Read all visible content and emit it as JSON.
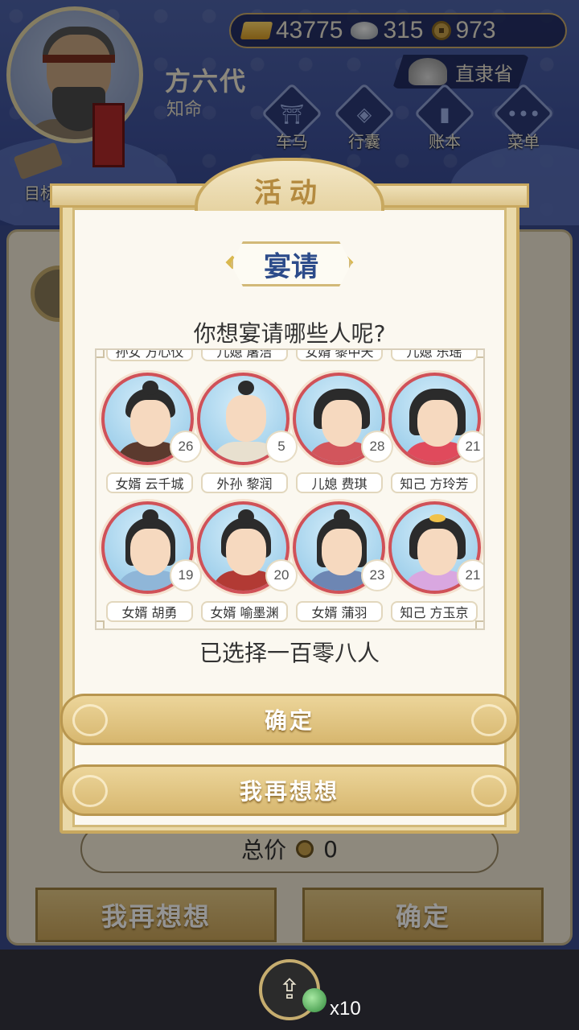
{
  "resources": {
    "gold": "43775",
    "silver": "315",
    "coins": "973"
  },
  "player": {
    "name": "方六代",
    "title": "知命",
    "province": "直隶省"
  },
  "menu": {
    "carriage": "车马",
    "bag": "行囊",
    "ledger": "账本",
    "menu": "菜单",
    "goal": "目标"
  },
  "background": {
    "total_label": "总价",
    "total_value": "0",
    "reconsider": "我再想想",
    "confirm": "确定",
    "share_count": "x10"
  },
  "dialog": {
    "title": "活动",
    "section": "宴请",
    "question": "你想宴请哪些人呢?",
    "partial_row": [
      "孙女 方心仪",
      "儿媳 屠洁",
      "女婿 黎中天",
      "儿媳 乐瑶"
    ],
    "characters": [
      {
        "label": "女婿 云千城",
        "age": "26"
      },
      {
        "label": "外孙 黎润",
        "age": "5"
      },
      {
        "label": "儿媳 费琪",
        "age": "28"
      },
      {
        "label": "知己 方玲芳",
        "age": "21"
      },
      {
        "label": "女婿 胡勇",
        "age": "19"
      },
      {
        "label": "女婿 喻墨渊",
        "age": "20"
      },
      {
        "label": "女婿 蒲羽",
        "age": "23"
      },
      {
        "label": "知己 方玉京",
        "age": "21"
      }
    ],
    "selected_text": "已选择一百零八人",
    "confirm": "确定",
    "reconsider": "我再想想"
  }
}
